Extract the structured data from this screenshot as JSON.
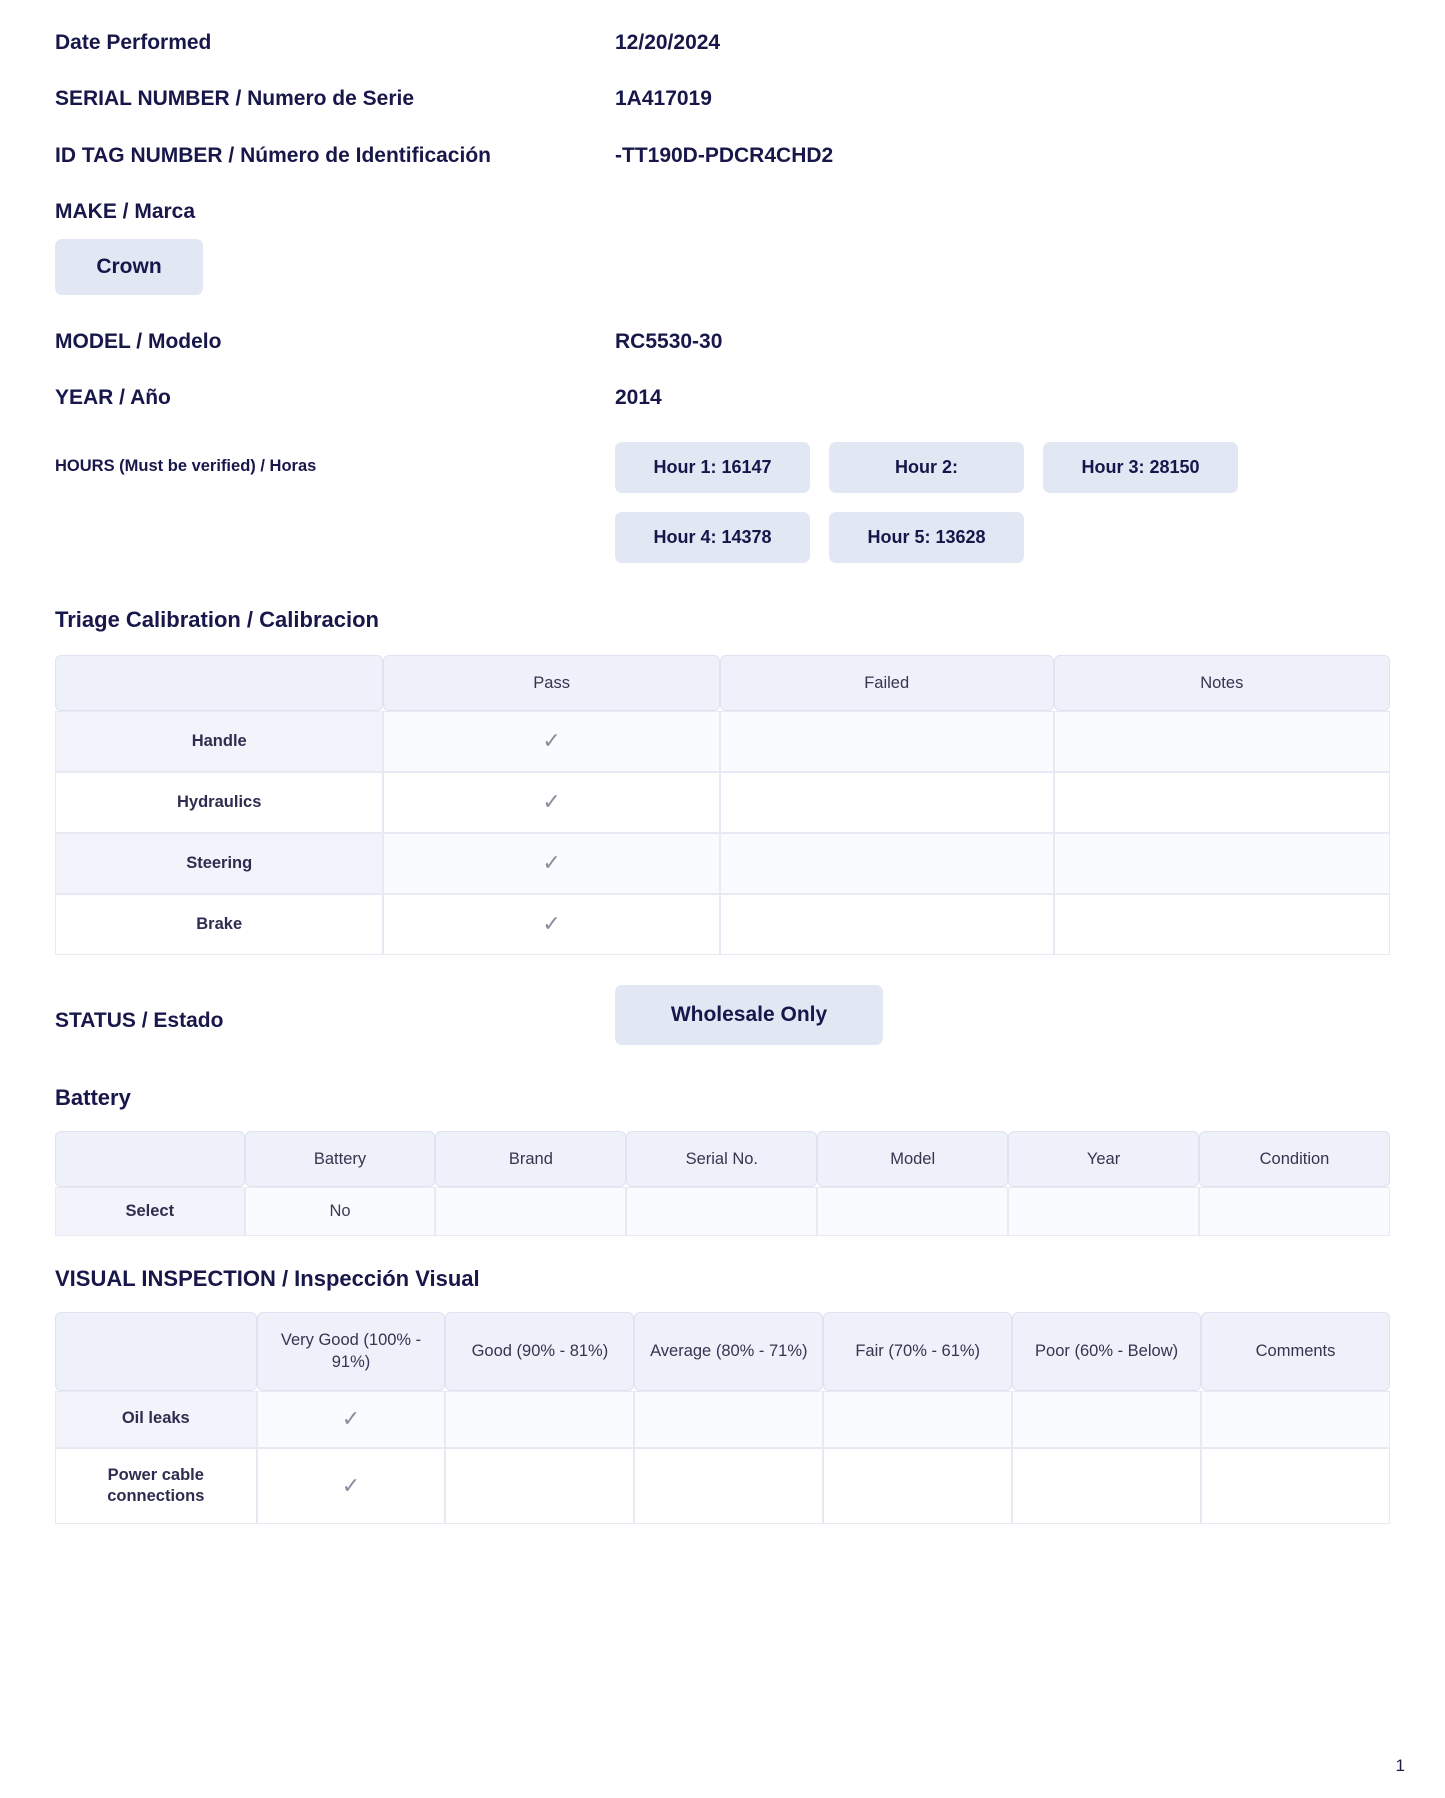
{
  "fields": {
    "date_performed": {
      "label": "Date Performed",
      "value": "12/20/2024"
    },
    "serial_number": {
      "label": "SERIAL NUMBER / Numero de Serie",
      "value": "1A417019"
    },
    "id_tag_number": {
      "label": "ID TAG NUMBER / Número de Identificación",
      "value": "-TT190D-PDCR4CHD2"
    },
    "make": {
      "label": "MAKE / Marca",
      "value": "Crown"
    },
    "model": {
      "label": "MODEL / Modelo",
      "value": "RC5530-30"
    },
    "year": {
      "label": "YEAR / Año",
      "value": "2014"
    },
    "hours": {
      "label": "HOURS (Must be verified) / Horas",
      "chips": [
        "Hour 1: 16147",
        "Hour 2:",
        "Hour 3: 28150",
        "Hour 4: 14378",
        "Hour 5: 13628"
      ]
    },
    "status": {
      "label": "STATUS / Estado",
      "value": "Wholesale Only"
    }
  },
  "triage": {
    "title": "Triage Calibration / Calibracion",
    "columns": [
      "",
      "Pass",
      "Failed",
      "Notes"
    ],
    "rows": [
      {
        "label": "Handle",
        "pass": "✓",
        "failed": "",
        "notes": ""
      },
      {
        "label": "Hydraulics",
        "pass": "✓",
        "failed": "",
        "notes": ""
      },
      {
        "label": "Steering",
        "pass": "✓",
        "failed": "",
        "notes": ""
      },
      {
        "label": "Brake",
        "pass": "✓",
        "failed": "",
        "notes": ""
      }
    ]
  },
  "battery": {
    "title": "Battery",
    "columns": [
      "",
      "Battery",
      "Brand",
      "Serial No.",
      "Model",
      "Year",
      "Condition"
    ],
    "rows": [
      {
        "label": "Select",
        "cells": [
          "No",
          "",
          "",
          "",
          "",
          ""
        ]
      }
    ]
  },
  "visual": {
    "title": "VISUAL INSPECTION / Inspección Visual",
    "columns": [
      "",
      "Very Good (100% - 91%)",
      "Good (90% - 81%)",
      "Average (80% - 71%)",
      "Fair (70% - 61%)",
      "Poor (60% - Below)",
      "Comments"
    ],
    "rows": [
      {
        "label": "Oil leaks",
        "cells": [
          "✓",
          "",
          "",
          "",
          "",
          ""
        ]
      },
      {
        "label": "Power cable connections",
        "cells": [
          "✓",
          "",
          "",
          "",
          "",
          ""
        ]
      }
    ]
  },
  "footer": {
    "page_number": "1"
  },
  "colors": {
    "text_navy": "#17174a",
    "chip_bg": "#e2e7f4",
    "table_header_bg": "#eef0fa",
    "row_alt_bg": "#f2f3fb",
    "check_gray": "#8c8c9e"
  }
}
